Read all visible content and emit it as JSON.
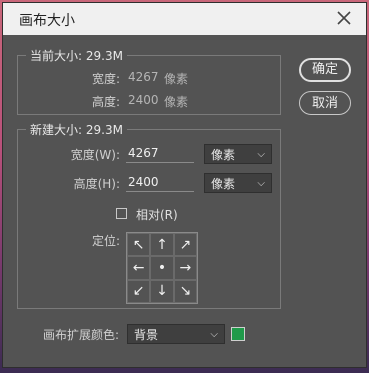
{
  "dialog": {
    "title": "画布大小"
  },
  "current": {
    "group_label": "当前大小: 29.3M",
    "width_label": "宽度:",
    "width_value": "4267",
    "width_unit": "像素",
    "height_label": "高度:",
    "height_value": "2400",
    "height_unit": "像素"
  },
  "new": {
    "group_label": "新建大小: 29.3M",
    "width_label": "宽度(W):",
    "width_value": "4267",
    "width_unit": "像素",
    "height_label": "高度(H):",
    "height_value": "2400",
    "height_unit": "像素",
    "relative_label": "相对(R)",
    "anchor_label": "定位:"
  },
  "buttons": {
    "ok": "确定",
    "cancel": "取消"
  },
  "extension": {
    "label": "画布扩展颜色:",
    "value": "背景",
    "swatch_color": "#1f9a4a"
  },
  "anchor": {
    "arrows": [
      "↖",
      "↑",
      "↗",
      "←",
      "•",
      "→",
      "↙",
      "↓",
      "↘"
    ]
  }
}
